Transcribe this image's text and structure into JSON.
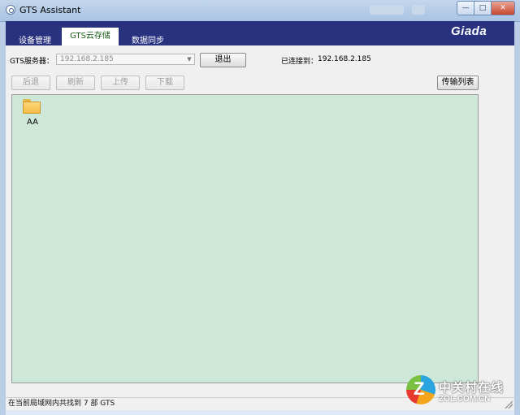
{
  "window": {
    "title": "GTS Assistant",
    "controls": {
      "minimize": "—",
      "maximize": "□",
      "close": "✕"
    }
  },
  "header": {
    "tabs": [
      {
        "label": "设备管理",
        "active": false
      },
      {
        "label": "GTS云存储",
        "active": true
      },
      {
        "label": "数据同步",
        "active": false
      }
    ],
    "logo": "Giada",
    "color": "#28327f"
  },
  "server": {
    "label": "GTS服务器：",
    "value": "192.168.2.185",
    "logout_label": "退出",
    "connected_label": "已连接到：",
    "connected_value": "192.168.2.185"
  },
  "toolbar": {
    "back": "后退",
    "refresh": "刷新",
    "upload": "上传",
    "download": "下载",
    "transfer_list": "传输列表"
  },
  "files": [
    {
      "name": "AA",
      "icon": "folder-icon"
    }
  ],
  "status": {
    "text": "在当前局域网内共找到 7 部 GTS"
  },
  "watermark": {
    "cn": "中关村在线",
    "en": "ZOL.COM.CN"
  },
  "colors": {
    "file_area_bg": "#cde8d9",
    "active_tab_text": "#1a5c1a"
  }
}
